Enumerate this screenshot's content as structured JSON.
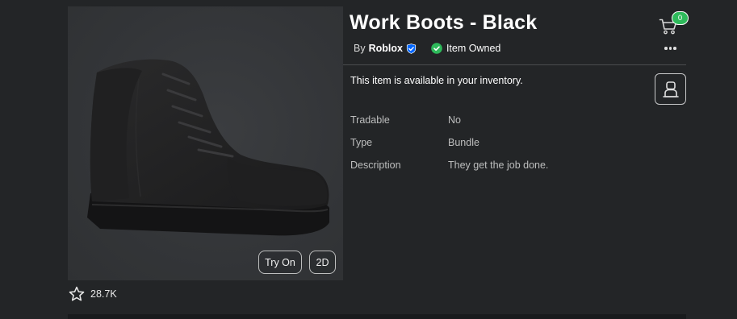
{
  "item": {
    "title": "Work Boots - Black",
    "by_label": "By",
    "creator": "Roblox",
    "owned_label": "Item Owned",
    "availability": "This item is available in your inventory."
  },
  "thumbnail": {
    "try_on_label": "Try On",
    "view_2d_label": "2D"
  },
  "favorites": {
    "count": "28.7K"
  },
  "cart": {
    "count": "0"
  },
  "details": [
    {
      "label": "Tradable",
      "value": "No"
    },
    {
      "label": "Type",
      "value": "Bundle"
    },
    {
      "label": "Description",
      "value": "They get the job done."
    }
  ],
  "icons": {
    "cart": "cart-icon",
    "more": "more-options-icon",
    "avatar": "avatar-outline-icon",
    "star": "star-outline-icon",
    "verified": "verified-badge-icon",
    "owned": "check-circle-icon"
  },
  "colors": {
    "background": "#232527",
    "owned_green": "#2eba5b",
    "verified_blue": "#0066ff"
  }
}
